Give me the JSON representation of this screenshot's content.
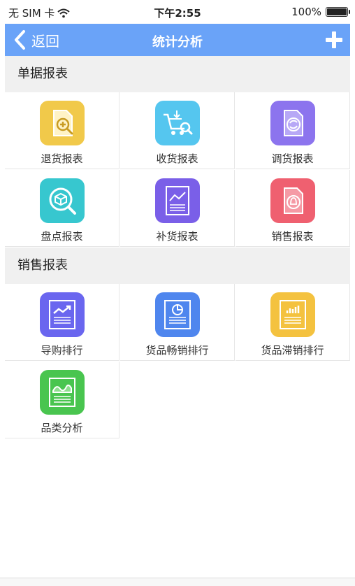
{
  "status_bar": {
    "carrier": "无 SIM 卡",
    "time": "下午2:55",
    "battery": "100%"
  },
  "nav": {
    "back_label": "返回",
    "title": "统计分析"
  },
  "sections": [
    {
      "title": "单据报表",
      "items": [
        {
          "label": "退货报表",
          "icon": "return-report-icon",
          "color": "#f1c94a"
        },
        {
          "label": "收货报表",
          "icon": "receiving-report-icon",
          "color": "#55c6ef"
        },
        {
          "label": "调货报表",
          "icon": "transfer-report-icon",
          "color": "#8c74ee"
        },
        {
          "label": "盘点报表",
          "icon": "inventory-report-icon",
          "color": "#37c7cf"
        },
        {
          "label": "补货报表",
          "icon": "restock-report-icon",
          "color": "#7a5fe8"
        },
        {
          "label": "销售报表",
          "icon": "sales-report-icon",
          "color": "#ef6070"
        }
      ]
    },
    {
      "title": "销售报表",
      "items": [
        {
          "label": "导购排行",
          "icon": "guide-ranking-icon",
          "color": "#6a66ef"
        },
        {
          "label": "货品畅销排行",
          "icon": "bestseller-ranking-icon",
          "color": "#4f86ee"
        },
        {
          "label": "货品滞销排行",
          "icon": "slow-seller-ranking-icon",
          "color": "#f4c23f"
        },
        {
          "label": "品类分析",
          "icon": "category-analysis-icon",
          "color": "#49c54f"
        }
      ]
    }
  ]
}
